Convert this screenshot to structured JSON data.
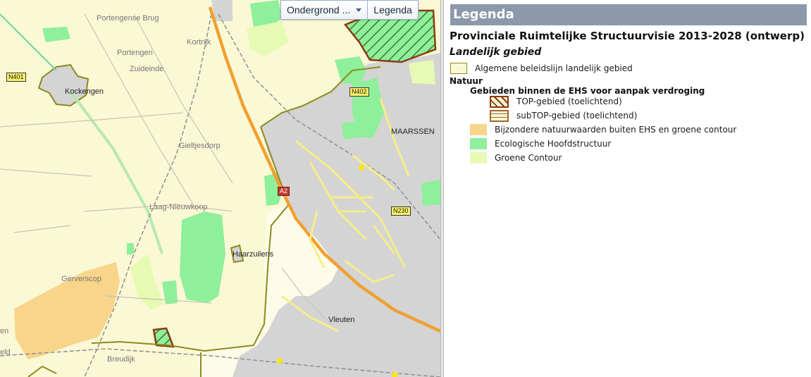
{
  "map": {
    "labels": {
      "portengense_brug": "Portengense Brug",
      "kortrijk": "Kortrijk",
      "portengen": "Portengen",
      "zuideinde": "Zuideinde",
      "kockengen": "Kockengen",
      "maarssen": "MAARSSEN",
      "gieltjesdorp": "Gieltjesdorp",
      "laag_nieuwkoop": "Laag-Nieuwkoop",
      "haarzuilens": "Haarzuilens",
      "gerverscop": "Gerverscop",
      "vleuten": "Vleuten",
      "breudijk": "Breudijk",
      "edge_en": "en",
      "edge_eld": "eld"
    },
    "road_shields": {
      "n401": "N401",
      "n402": "N402",
      "n230": "N230",
      "a2": "A2"
    },
    "toolbar": {
      "basemap_label": "Ondergrond ...",
      "legend_label": "Legenda"
    }
  },
  "legend": {
    "header": "Legenda",
    "title": "Provinciale Ruimtelijke Structuurvisie 2013-2028 (ontwerp)",
    "subtitle": "Landelijk gebied",
    "item_landelijk": "Algemene beleidslijn landelijk gebied",
    "group_natuur": "Natuur",
    "group_ehs": "Gebieden binnen de EHS voor aanpak verdroging",
    "item_top": "TOP-gebied (toelichtend)",
    "item_subtop": "subTOP-gebied (toelichtend)",
    "item_bijzondere": "Bijzondere natuurwaarden buiten EHS en groene contour",
    "item_ehs": "Ecologische Hoofdstructuur",
    "item_groene": "Groene Contour"
  },
  "colors": {
    "landelijk_fill": "#fbf8d6",
    "landelijk_border": "#8c8a1e",
    "top_border": "#8b3a12",
    "bijzondere": "#f8d58a",
    "ehs": "#8ef09a",
    "groene_contour": "#e6fab4",
    "urban": "#d4d4d4",
    "legend_header_bg": "#8c99ab",
    "highway": "#f0a030"
  }
}
